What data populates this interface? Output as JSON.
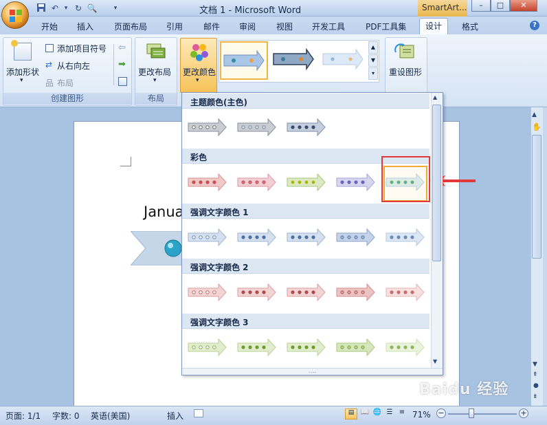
{
  "window": {
    "title": "文档 1 - Microsoft Word",
    "context_tab": "SmartArt...",
    "minimize": "–",
    "maximize": "□",
    "close": "✕"
  },
  "tabs": [
    {
      "label": "开始"
    },
    {
      "label": "插入"
    },
    {
      "label": "页面布局"
    },
    {
      "label": "引用"
    },
    {
      "label": "邮件"
    },
    {
      "label": "审阅"
    },
    {
      "label": "视图"
    },
    {
      "label": "开发工具"
    },
    {
      "label": "PDF工具集"
    },
    {
      "label": "设计"
    },
    {
      "label": "格式"
    }
  ],
  "active_tab": "设计",
  "ribbon": {
    "create_group": {
      "add_shape": "添加形状",
      "add_bullet": "添加项目符号",
      "right_to_left": "从右向左",
      "layout": "布局",
      "label": "创建图形"
    },
    "layout_group": {
      "change_layout": "更改布局",
      "label": "布局"
    },
    "change_color": "更改颜色",
    "reset_graphic": "重设图形"
  },
  "gallery": {
    "sections": [
      {
        "title": "主题颜色(主色)",
        "count": 3
      },
      {
        "title": "彩色",
        "count": 5
      },
      {
        "title": "强调文字颜色 1",
        "count": 5
      },
      {
        "title": "强调文字颜色 2",
        "count": 5
      },
      {
        "title": "强调文字颜色 3",
        "count": 5
      }
    ],
    "more_indicator": "....",
    "selected": "彩色 5"
  },
  "document": {
    "text": "Janua"
  },
  "statusbar": {
    "page": "页面: 1/1",
    "words": "字数: 0",
    "language": "英语(美国)",
    "insert_mode": "插入",
    "zoom": "71%"
  },
  "watermark": "Baidu 经验",
  "colors": {
    "accent_red": "#e23a3a",
    "ribbon_blue": "#d4e3f4",
    "selection_orange": "#f0a93a"
  }
}
